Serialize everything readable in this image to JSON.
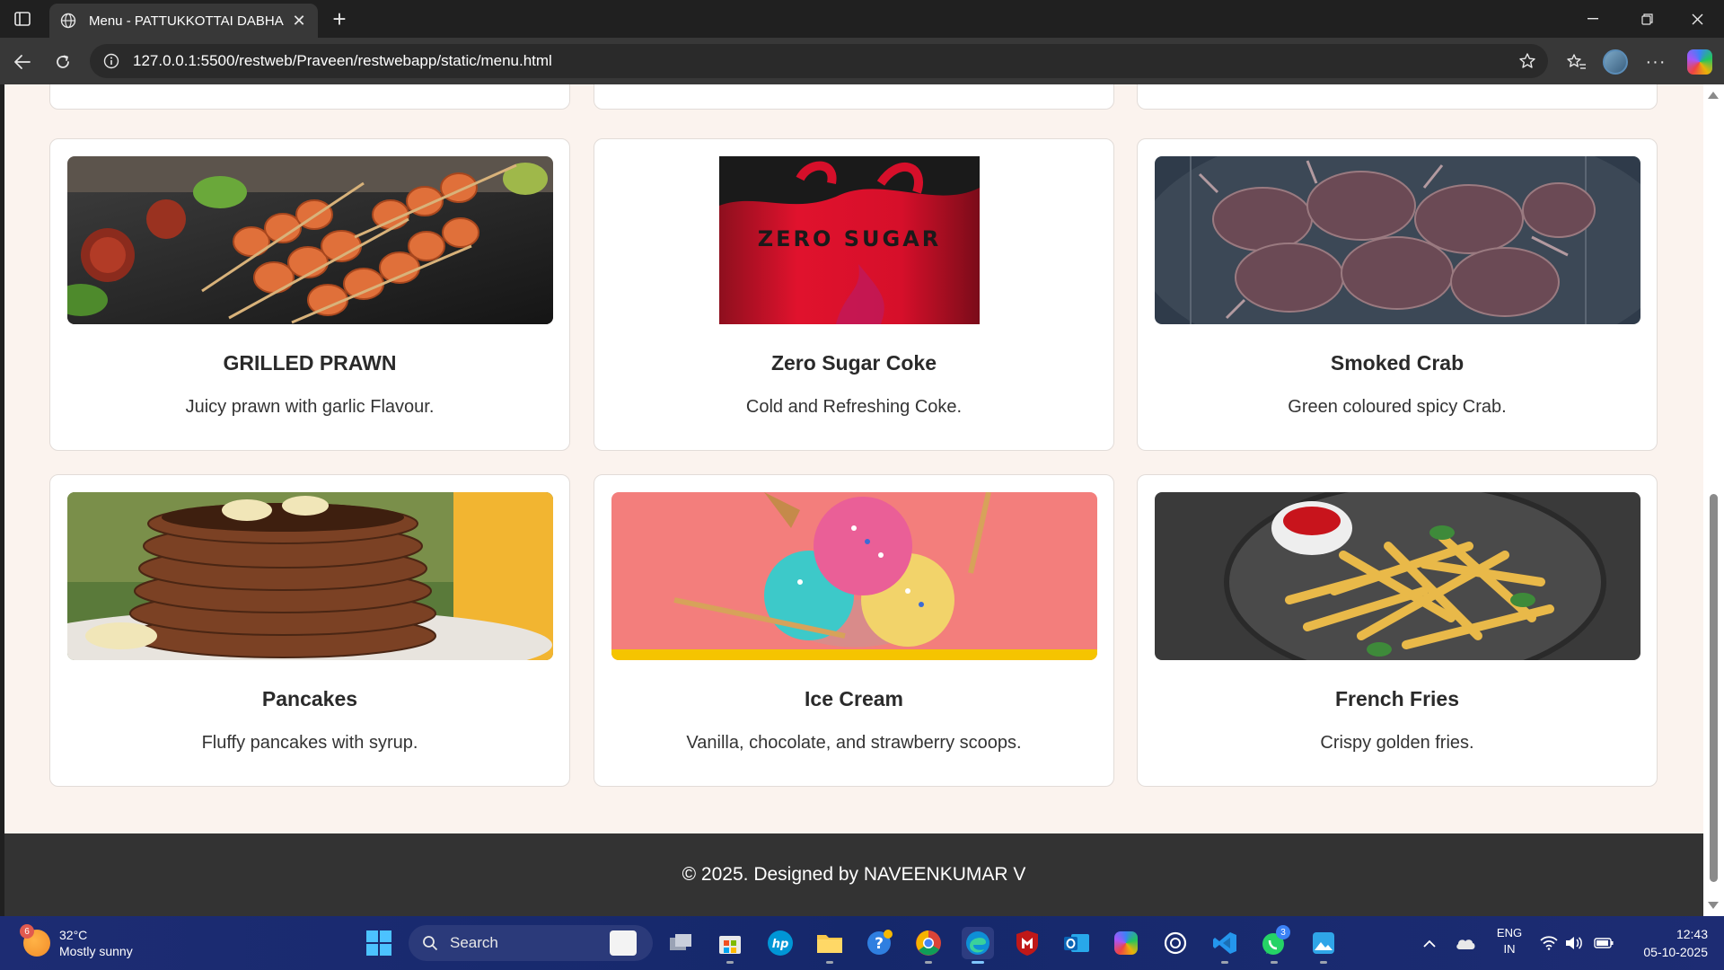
{
  "browser": {
    "tab_title": "Menu - PATTUKKOTTAI DABHA",
    "url": "127.0.0.1:5500/restweb/Praveen/restwebapp/static/menu.html"
  },
  "menu": {
    "items": [
      {
        "name": "GRILLED PRAWN",
        "description": "Juicy prawn with garlic Flavour.",
        "image": "grilled-prawn"
      },
      {
        "name": "Zero Sugar Coke",
        "description": "Cold and Refreshing Coke.",
        "image": "coke-can",
        "image_text": "ZERO SUGAR"
      },
      {
        "name": "Smoked Crab",
        "description": "Green coloured spicy Crab.",
        "image": "smoked-crab"
      },
      {
        "name": "Pancakes",
        "description": "Fluffy pancakes with syrup.",
        "image": "pancakes"
      },
      {
        "name": "Ice Cream",
        "description": "Vanilla, chocolate, and strawberry scoops.",
        "image": "ice-cream"
      },
      {
        "name": "French Fries",
        "description": "Crispy golden fries.",
        "image": "french-fries"
      }
    ]
  },
  "footer": {
    "text": "© 2025. Designed by NAVEENKUMAR V"
  },
  "taskbar": {
    "weather": {
      "temp": "32°C",
      "condition": "Mostly sunny",
      "badge": "6"
    },
    "search_label": "Search",
    "whatsapp_badge": "3",
    "lang_top": "ENG",
    "lang_bottom": "IN",
    "time": "12:43",
    "date": "05-10-2025"
  },
  "colors": {
    "page_bg": "#fbf3ee",
    "footer_bg": "#333333",
    "card_bg": "#ffffff",
    "chrome_dark": "#202020",
    "taskbar_bg": "#1d2c73"
  }
}
